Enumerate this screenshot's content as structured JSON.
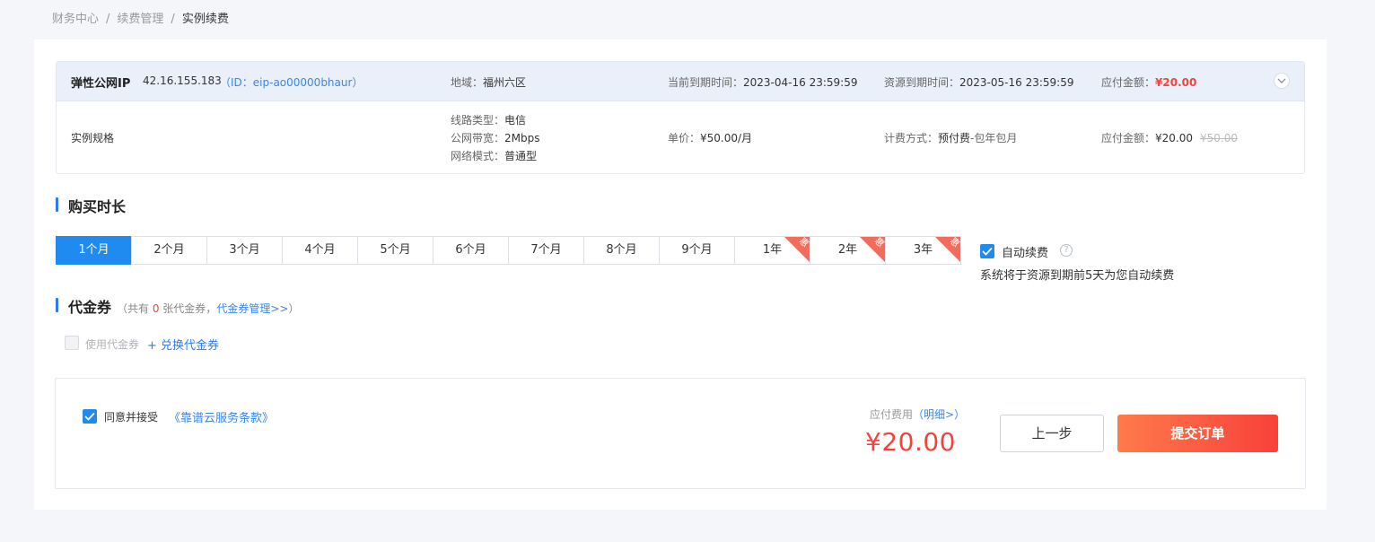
{
  "breadcrumb": [
    "财务中心",
    "续费管理",
    "实例续费"
  ],
  "instance": {
    "name": "弹性公网IP",
    "ip": "42.16.155.183",
    "id_text": "（ID：eip-ao00000bhaur）",
    "region_label": "地域：",
    "region": "福州六区",
    "current_expire_label": "当前到期时间：",
    "current_expire": "2023-04-16 23:59:59",
    "resource_expire_label": "资源到期时间：",
    "resource_expire": "2023-05-16 23:59:59",
    "amount_label": "应付金额：",
    "amount": "¥20.00",
    "spec_label": "实例规格",
    "line_type_label": "线路类型：",
    "line_type": "电信",
    "bandwidth_label": "公网带宽：",
    "bandwidth": "2Mbps",
    "network_mode_label": "网络模式：",
    "network_mode": "普通型",
    "unit_price_label": "单价：",
    "unit_price": "¥50.00/月",
    "billing_label": "计费方式：",
    "billing": "预付费",
    "billing_suffix": "-包年包月",
    "payable_label": "应付金额：",
    "payable": "¥20.00",
    "original_price": "¥50.00"
  },
  "duration": {
    "title": "购买时长",
    "selected_index": 0,
    "options": [
      {
        "label": "1个月"
      },
      {
        "label": "2个月"
      },
      {
        "label": "3个月"
      },
      {
        "label": "4个月"
      },
      {
        "label": "5个月"
      },
      {
        "label": "6个月"
      },
      {
        "label": "7个月"
      },
      {
        "label": "8个月"
      },
      {
        "label": "9个月"
      },
      {
        "label": "1年",
        "badge": "惠"
      },
      {
        "label": "2年",
        "badge": "惠"
      },
      {
        "label": "3年",
        "badge": "惠"
      }
    ],
    "auto_renew_label": "自动续费",
    "auto_renew_checked": true,
    "help_glyph": "?",
    "auto_renew_note": "系统将于资源到期前5天为您自动续费"
  },
  "voucher": {
    "title": "代金券",
    "note_prefix": "（共有 ",
    "count": "0",
    "note_middle": " 张代金券，",
    "manage_link": "代金券管理>>",
    "note_suffix": "）",
    "use_label": "使用代金券",
    "exchange_label": "+ 兑换代金券"
  },
  "footer": {
    "agree_label": "同意并接受",
    "terms_link": "《靠谱云服务条款》",
    "fee_label": "应付费用",
    "detail_link": "（明细>）",
    "fee_amount": "¥20.00",
    "prev_button": "上一步",
    "submit_button": "提交订单"
  },
  "colors": {
    "accent": "#1f8af0",
    "price_red": "#f0443c",
    "link_blue": "#3a86e8",
    "submit_gradient_start": "#ff7a4c",
    "submit_gradient_end": "#f8413a"
  }
}
